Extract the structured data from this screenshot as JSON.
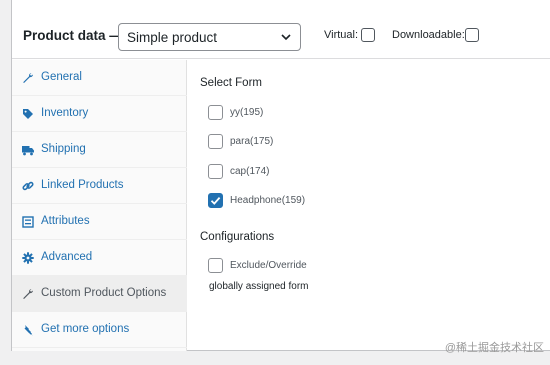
{
  "header": {
    "title": "Product data —",
    "product_type": "Simple product",
    "virtual_label": "Virtual:",
    "virtual_checked": false,
    "downloadable_label": "Downloadable:",
    "downloadable_checked": false
  },
  "tabs": [
    {
      "label": "General",
      "icon": "wrench-icon",
      "active": false
    },
    {
      "label": "Inventory",
      "icon": "tag-icon",
      "active": false
    },
    {
      "label": "Shipping",
      "icon": "truck-icon",
      "active": false
    },
    {
      "label": "Linked Products",
      "icon": "link-icon",
      "active": false
    },
    {
      "label": "Attributes",
      "icon": "list-icon",
      "active": false
    },
    {
      "label": "Advanced",
      "icon": "gear-icon",
      "active": false
    },
    {
      "label": "Custom Product Options",
      "icon": "wrench-icon",
      "active": true
    },
    {
      "label": "Get more options",
      "icon": "plugin-icon",
      "active": false
    }
  ],
  "select_form": {
    "title": "Select Form",
    "forms": [
      {
        "label": "yy(195)",
        "checked": false
      },
      {
        "label": "para(175)",
        "checked": false
      },
      {
        "label": "cap(174)",
        "checked": false
      },
      {
        "label": "Headphone(159)",
        "checked": true
      }
    ]
  },
  "configurations": {
    "title": "Configurations",
    "exclude_label": "Exclude/Override",
    "exclude_checked": false,
    "note": "globally assigned form"
  },
  "watermark": "@稀土掘金技术社区",
  "colors": {
    "accent": "#2271b1",
    "text": "#1d2327",
    "muted": "#50575e"
  }
}
